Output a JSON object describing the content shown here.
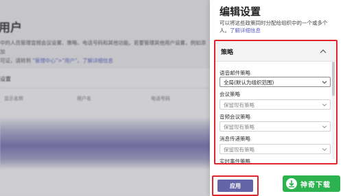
{
  "background": {
    "page_title": "用户",
    "description_line1": "中的人员管理音频会议设置、策略、电话号码和其他功能。若要管理其他用户设置，例如添加",
    "description_line2_prefix": "可证，请转到 ",
    "description_link": "\"管理中心\">\"用户\"。了解详细信息",
    "section_title": "设置",
    "columns": [
      "显示名称",
      "用户名",
      "电话号码"
    ]
  },
  "panel": {
    "title": "编辑设置",
    "description": "可以将这些政策同时分配给组织中的一个或多个人。",
    "description_link": "了解详细信息",
    "section_title": "策略",
    "fields": [
      {
        "label": "语音邮件策略",
        "value": "全局(默认为组织范围)"
      },
      {
        "label": "会议策略",
        "value": "保留现有策略"
      },
      {
        "label": "音频会议策略",
        "value": "保留现有策略"
      },
      {
        "label": "消息传递策略",
        "value": "保留现有策略"
      },
      {
        "label": "实时事件策略",
        "value": ""
      }
    ],
    "apply_label": "应用"
  },
  "watermark": {
    "text": "神奇下载"
  },
  "colors": {
    "accent": "#6264a7",
    "highlight": "#e0242b",
    "watermark": "#2db250"
  }
}
